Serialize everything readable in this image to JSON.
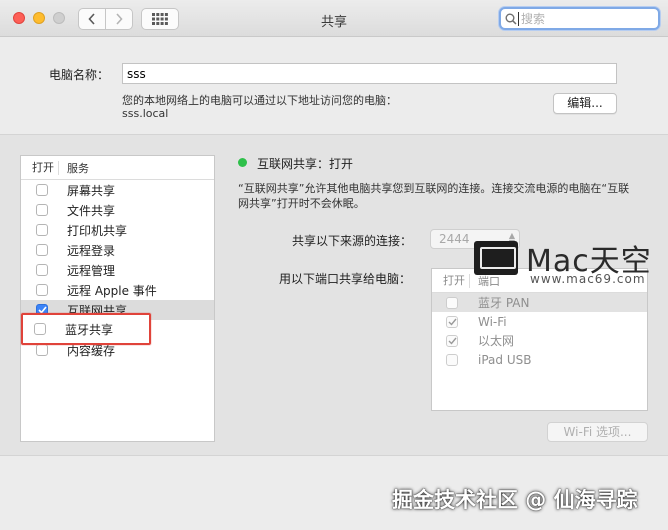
{
  "window": {
    "title": "共享",
    "search_placeholder": "搜索"
  },
  "computer": {
    "name_label": "电脑名称：",
    "name_value": "sss",
    "address_note": "您的本地网络上的电脑可以通过以下地址访问您的电脑：",
    "address": "sss.local",
    "edit_label": "编辑..."
  },
  "services": {
    "col_on": "打开",
    "col_service": "服务",
    "items": [
      {
        "label": "屏幕共享",
        "checked": false
      },
      {
        "label": "文件共享",
        "checked": false
      },
      {
        "label": "打印机共享",
        "checked": false
      },
      {
        "label": "远程登录",
        "checked": false
      },
      {
        "label": "远程管理",
        "checked": false
      },
      {
        "label": "远程 Apple 事件",
        "checked": false
      },
      {
        "label": "互联网共享",
        "checked": true,
        "selected": true
      },
      {
        "label": "蓝牙共享",
        "checked": false,
        "highlighted": true
      },
      {
        "label": "内容缓存",
        "checked": false
      }
    ]
  },
  "detail": {
    "status_label": "互联网共享：打开",
    "status_color": "#2ec04a",
    "description_line1": "“互联网共享”允许其他电脑共享您到互联网的连接。连接交流电源的电脑在“互联",
    "description_line2": "网共享”打开时不会休眠。",
    "source_label": "共享以下来源的连接：",
    "source_value": "2444",
    "ports_label": "用以下端口共享给电脑：",
    "ports_col_on": "打开",
    "ports_col_port": "端口",
    "ports": [
      {
        "label": "蓝牙 PAN",
        "checked": false,
        "selected": true
      },
      {
        "label": "Wi-Fi",
        "checked": true
      },
      {
        "label": "以太网",
        "checked": true
      },
      {
        "label": "iPad USB",
        "checked": false
      }
    ],
    "wifi_options_label": "Wi-Fi 选项..."
  },
  "watermarks": {
    "mac_logo_text": "Mac天空",
    "mac_url": "www.mac69.com",
    "footer": "掘金技术社区 @ 仙海寻踪"
  },
  "colors": {
    "highlight_box": "#e0433a",
    "checkbox_checked": "#3b83f7"
  }
}
